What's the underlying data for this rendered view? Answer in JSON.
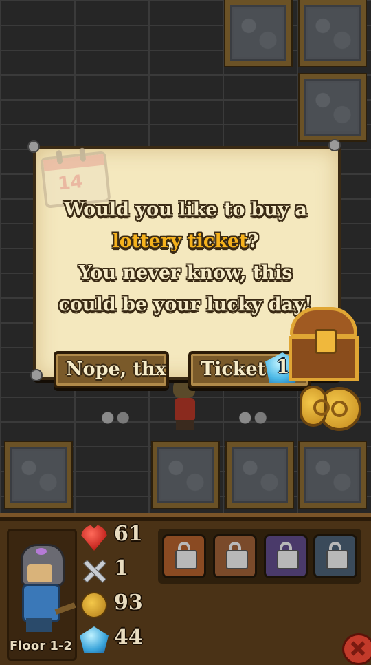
{
  "dialog": {
    "line1": "Would you like to buy a",
    "highlight": "lottery ticket",
    "line2_end": "?",
    "line3": "You never know, this",
    "line4": "could be your lucky day!",
    "calendar_day": "14"
  },
  "buttons": {
    "decline_label": "Nope, thx",
    "accept_label": "Ticket",
    "ticket_cost": "1"
  },
  "hud": {
    "floor_label": "Floor 1-2",
    "health": "61",
    "attack": "1",
    "gold": "93",
    "gems": "44"
  },
  "icons": {
    "health": "heart-icon",
    "attack": "crossed-swords-icon",
    "gold": "gold-coin-icon",
    "gems": "crystal-gem-icon",
    "slots": "padlock-icon",
    "menu": "close-icon"
  },
  "colors": {
    "highlight": "#f6b21c",
    "parchment": "#f4e8be",
    "hud_bg": "#4a3216"
  }
}
